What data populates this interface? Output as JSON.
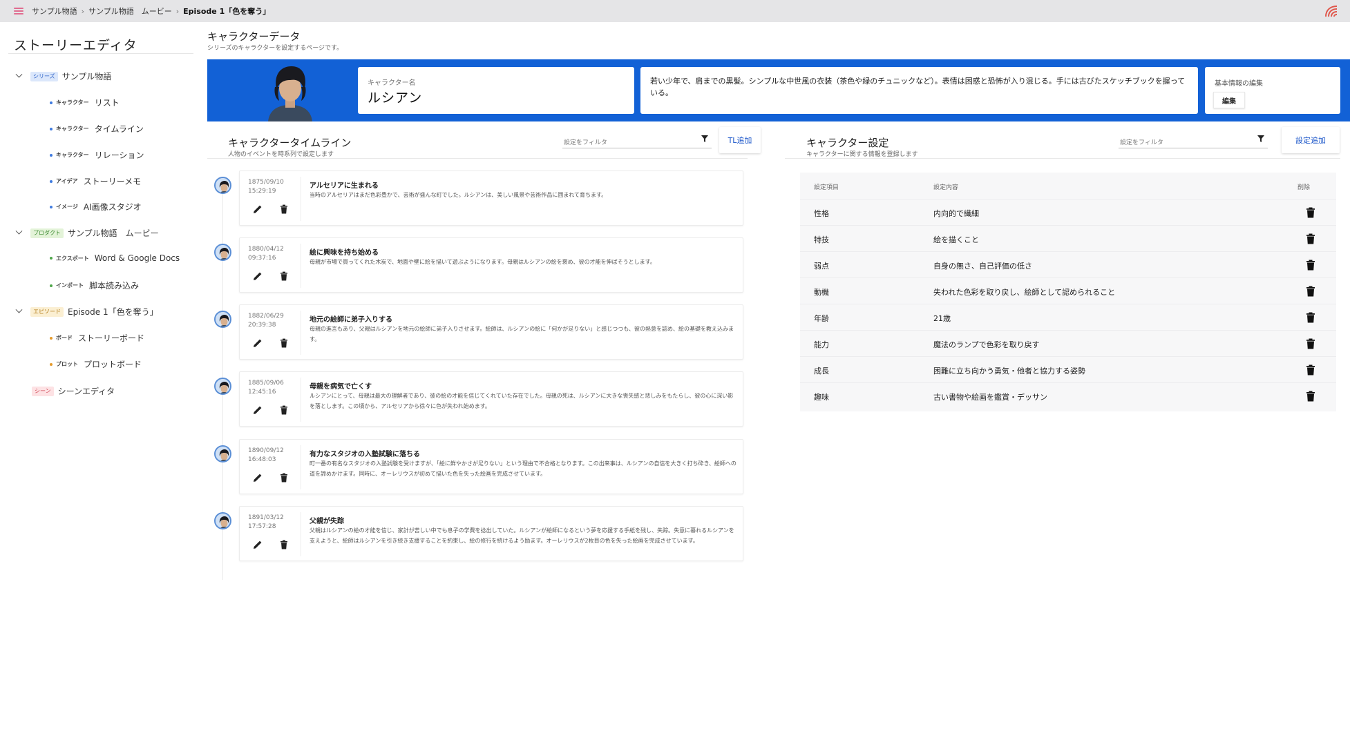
{
  "breadcrumb": [
    "サンプル物語",
    "サンプル物語　ムービー",
    "Episode 1「色を奪う」"
  ],
  "sidebar": {
    "title": "ストーリーエディタ",
    "series": {
      "badge": "シリーズ",
      "label": "サンプル物語",
      "children": [
        {
          "tag": "キャラクター",
          "label": "リスト"
        },
        {
          "tag": "キャラクター",
          "label": "タイムライン"
        },
        {
          "tag": "キャラクター",
          "label": "リレーション"
        },
        {
          "tag": "アイデア",
          "label": "ストーリーメモ"
        },
        {
          "tag": "イメージ",
          "label": "AI画像スタジオ"
        }
      ]
    },
    "product": {
      "badge": "プロダクト",
      "label": "サンプル物語　ムービー",
      "children": [
        {
          "tag": "エクスポート",
          "label": "Word & Google Docs"
        },
        {
          "tag": "インポート",
          "label": "脚本読み込み"
        }
      ]
    },
    "episode": {
      "badge": "エピソード",
      "label": "Episode 1「色を奪う」",
      "children": [
        {
          "tag": "ボード",
          "label": "ストーリーボード"
        },
        {
          "tag": "プロット",
          "label": "プロットボード"
        }
      ]
    },
    "scene": {
      "badge": "シーン",
      "label": "シーンエディタ"
    }
  },
  "header": {
    "title": "キャラクターデータ",
    "subtitle": "シリーズのキャラクターを設定するページです。"
  },
  "character": {
    "name_label": "キャラクター名",
    "name": "ルシアン",
    "description": "若い少年で、肩までの黒髪。シンプルな中世風の衣装（茶色や緑のチュニックなど）。表情は困惑と恐怖が入り混じる。手には古びたスケッチブックを握っている。",
    "info_label": "基本情報の編集",
    "edit_button": "編集"
  },
  "timeline": {
    "title": "キャラクタータイムライン",
    "subtitle": "人物のイベントを時系列で設定します",
    "filter_placeholder": "設定をフィルタ",
    "add_button": "TL追加",
    "events": [
      {
        "date": "1875/09/10",
        "time": "15:29:19",
        "title": "アルセリアに生まれる",
        "body": "当時のアルセリアはまだ色彩豊かで、芸術が盛んな町でした。ルシアンは、美しい風景や芸術作品に囲まれて育ちます。"
      },
      {
        "date": "1880/04/12",
        "time": "09:37:16",
        "title": "絵に興味を持ち始める",
        "body": "母親が市場で買ってくれた木炭で、地面や壁に絵を描いて遊ぶようになります。母親はルシアンの絵を褒め、彼の才能を伸ばそうとします。"
      },
      {
        "date": "1882/06/29",
        "time": "20:39:38",
        "title": "地元の絵師に弟子入りする",
        "body": "母親の進言もあり、父親はルシアンを地元の絵師に弟子入りさせます。絵師は、ルシアンの絵に「何かが足りない」と感じつつも、彼の熱意を認め、絵の基礎を教え込みます。"
      },
      {
        "date": "1885/09/06",
        "time": "12:45:16",
        "title": "母親を病気で亡くす",
        "body": "ルシアンにとって、母親は最大の理解者であり、彼の絵の才能を信じてくれていた存在でした。母親の死は、ルシアンに大きな喪失感と悲しみをもたらし、彼の心に深い影を落とします。この頃から、アルセリアから徐々に色が失われ始めます。"
      },
      {
        "date": "1890/09/12",
        "time": "16:48:03",
        "title": "有力なスタジオの入塾試験に落ちる",
        "body": "町一番の有名なスタジオの入塾試験を受けますが、「絵に鮮やかさが足りない」という理由で不合格となります。この出来事は、ルシアンの自信を大きく打ち砕き、絵師への道を諦めかけます。同時に、オーレリウスが初めて描いた色を失った絵画を完成させています。"
      },
      {
        "date": "1891/03/12",
        "time": "17:57:28",
        "title": "父親が失踪",
        "body": "父親はルシアンの絵の才能を信じ、家計が苦しい中でも息子の学費を捻出していた。ルシアンが絵師になるという夢を応援する手紙を残し、失踪。失意に暮れるルシアンを支えようと、絵師はルシアンを引き続き支援することを約束し、絵の修行を続けるよう励ます。オーレリウスが2枚目の色を失った絵画を完成させています。"
      }
    ]
  },
  "settings": {
    "title": "キャラクター設定",
    "subtitle": "キャラクターに関する情報を登録します",
    "filter_placeholder": "設定をフィルタ",
    "add_button": "設定追加",
    "columns": {
      "key": "設定項目",
      "value": "設定内容",
      "delete": "削除"
    },
    "rows": [
      {
        "key": "性格",
        "value": "内向的で繊細"
      },
      {
        "key": "特技",
        "value": "絵を描くこと"
      },
      {
        "key": "弱点",
        "value": "自身の無さ、自己評価の低さ"
      },
      {
        "key": "動機",
        "value": "失われた色彩を取り戻し、絵師として認められること"
      },
      {
        "key": "年齢",
        "value": "21歳"
      },
      {
        "key": "能力",
        "value": "魔法のランプで色彩を取り戻す"
      },
      {
        "key": "成長",
        "value": "困難に立ち向かう勇気・他者と協力する姿勢"
      },
      {
        "key": "趣味",
        "value": "古い書物や絵画を鑑賞・デッサン"
      }
    ]
  },
  "colors": {
    "accent": "#1261d6",
    "link": "#1a55c9"
  }
}
